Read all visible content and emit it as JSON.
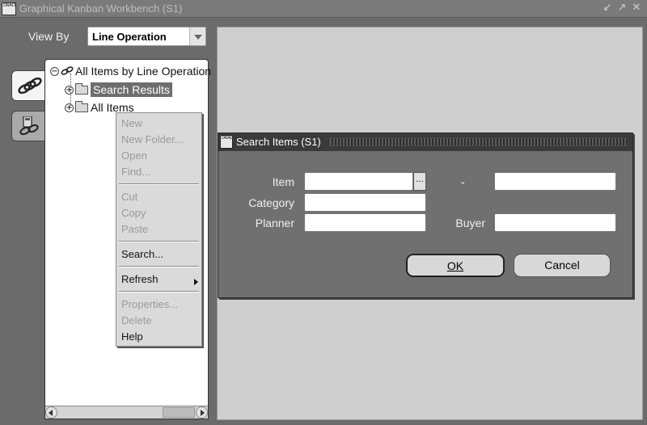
{
  "window": {
    "title": "Graphical Kanban Workbench (S1)",
    "icon": "oracle-app-icon",
    "controls": [
      "shrink-icon",
      "restore-icon",
      "close-icon"
    ]
  },
  "viewby": {
    "label": "View By",
    "selected": "Line Operation"
  },
  "tree": {
    "root": "All Items by Line Operation",
    "nodes": [
      "Search Results",
      "All Items"
    ]
  },
  "context_menu": {
    "items": [
      "New",
      "New Folder...",
      "Open",
      "Find...",
      "Cut",
      "Copy",
      "Paste",
      "Search...",
      "Refresh",
      "Properties...",
      "Delete",
      "Help"
    ],
    "disabled": [
      "New",
      "New Folder...",
      "Open",
      "Find...",
      "Cut",
      "Copy",
      "Paste",
      "Properties...",
      "Delete"
    ]
  },
  "dialog": {
    "title": "Search Items (S1)",
    "item_label": "Item",
    "range_separator": "-",
    "category_label": "Category",
    "planner_label": "Planner",
    "buyer_label": "Buyer",
    "lov_button": "...",
    "ok_label": "OK",
    "cancel_label": "Cancel",
    "item_from_value": "",
    "item_to_value": "",
    "category_value": "",
    "planner_value": "",
    "buyer_value": ""
  }
}
